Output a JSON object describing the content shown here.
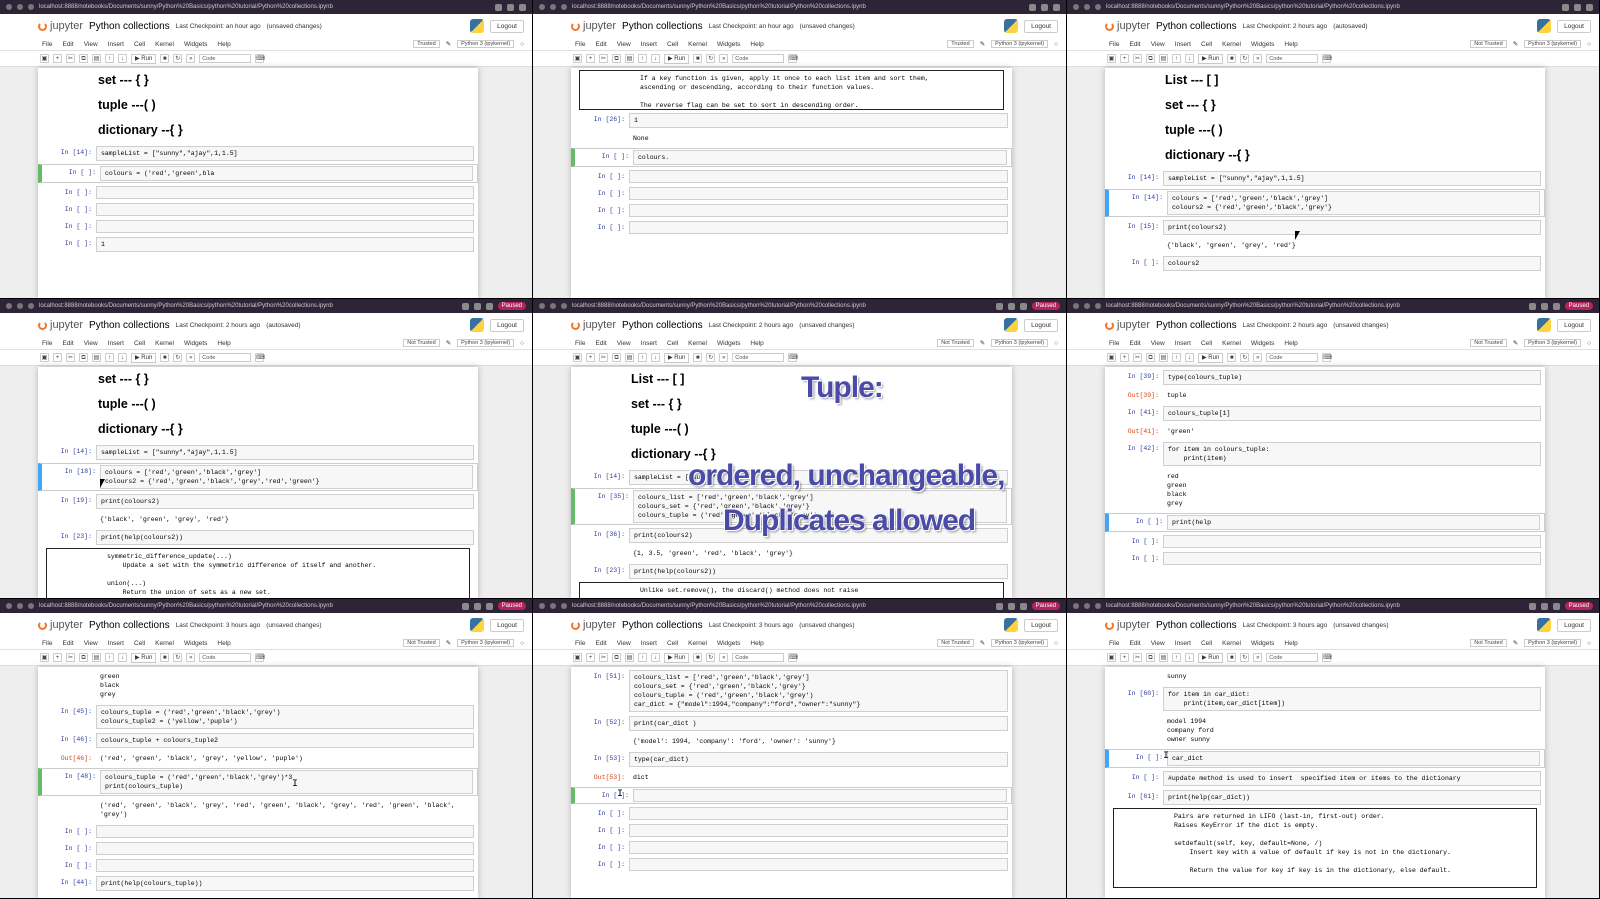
{
  "app": {
    "logo": "jupyter",
    "title": "Python collections",
    "python_label": "Python 3 (ipykernel)",
    "logout": "Logout",
    "not_trusted": "Not Trusted",
    "trusted": "Trusted",
    "paused": "Paused"
  },
  "menu": [
    "File",
    "Edit",
    "View",
    "Insert",
    "Cell",
    "Kernel",
    "Widgets",
    "Help"
  ],
  "toolbar": {
    "run": "Run",
    "celltype": "Code"
  },
  "url": "localhost:8888/notebooks/Documents/sunny/Python%20Basics/python%20tutorial/Python%20collections.ipynb",
  "frames": [
    {
      "checkpoint": "Last Checkpoint: an hour ago",
      "status": "(unsaved changes)",
      "headings": [
        "set --- { }",
        "tuple ---( )",
        "dictionary --{ }"
      ],
      "cells": [
        {
          "prompt": "In [14]:",
          "code": "sampleList = [\"sunny\",\"ajay\",1,1.5]"
        },
        {
          "prompt": "In [ ]:",
          "code": "colours = ('red','green',bla"
        },
        {
          "prompt": "In [ ]:",
          "code": ""
        },
        {
          "prompt": "In [ ]:",
          "code": ""
        },
        {
          "prompt": "In [ ]:",
          "code": ""
        },
        {
          "prompt": "In [ ]:",
          "code": "1"
        }
      ]
    },
    {
      "checkpoint": "Last Checkpoint: an hour ago",
      "status": "(unsaved changes)",
      "help": "If a key function is given, apply it once to each list item and sort them,\nascending or descending, according to their function values.\n\nThe reverse flag can be set to sort in descending order.\n\n----------------------------------------------------------------------\nClass methods defined here:",
      "cells": [
        {
          "prompt": "In [26]:",
          "code": "1"
        },
        {
          "output": "None"
        },
        {
          "prompt": "In [ ]:",
          "code": "colours."
        },
        {
          "prompt": "In [ ]:",
          "code": ""
        },
        {
          "prompt": "In [ ]:",
          "code": ""
        },
        {
          "prompt": "In [ ]:",
          "code": ""
        },
        {
          "prompt": "In [ ]:",
          "code": ""
        }
      ]
    },
    {
      "checkpoint": "Last Checkpoint: 2 hours ago",
      "status": "(autosaved)",
      "headings": [
        "List --- [ ]",
        "set --- { }",
        "tuple ---( )",
        "dictionary --{ }"
      ],
      "cells": [
        {
          "prompt": "In [14]:",
          "code": "sampleList = [\"sunny\",\"ajay\",1,1.5]"
        },
        {
          "prompt": "In [14]:",
          "code": "colours = ['red','green','black','grey']\ncolours2 = {'red','green','black','grey'}"
        },
        {
          "prompt": "In [15]:",
          "code": "print(colours2)"
        },
        {
          "output": "{'black', 'green', 'grey', 'red'}"
        },
        {
          "prompt": "In [ ]:",
          "code": "colours2"
        }
      ]
    },
    {
      "checkpoint": "Last Checkpoint: 2 hours ago",
      "status": "(autosaved)",
      "headings": [
        "set --- { }",
        "tuple ---( )",
        "dictionary --{ }"
      ],
      "cells": [
        {
          "prompt": "In [14]:",
          "code": "sampleList = [\"sunny\",\"ajay\",1,1.5]"
        },
        {
          "prompt": "In [18]:",
          "code": "colours = ['red','green','black','grey']\ncolours2 = {'red','green','black','grey','red','green'}"
        },
        {
          "prompt": "In [19]:",
          "code": "print(colours2)"
        },
        {
          "output": "{'black', 'green', 'grey', 'red'}"
        },
        {
          "prompt": "In [23]:",
          "code": "print(help(colours2))"
        }
      ],
      "help": "symmetric_difference_update(...)\n    Update a set with the symmetric difference of itself and another.\n\nunion(...)\n    Return the union of sets as a new set."
    },
    {
      "checkpoint": "Last Checkpoint: 2 hours ago",
      "status": "(unsaved changes)",
      "headings": [
        "List --- [ ]",
        "set --- { }",
        "tuple ---( )",
        "dictionary --{ }"
      ],
      "overlay": [
        "Tuple:",
        "ordered, unchangeable,",
        "Duplicates allowed"
      ],
      "cells": [
        {
          "prompt": "In [14]:",
          "code": "sampleList = [\"sunny\","
        },
        {
          "prompt": "In [35]:",
          "code": "colours_list = ['red','green','black','grey']\ncolours_set = {'red','green','black','grey'}\ncolours_tuple = ('red','green','black','grey')"
        },
        {
          "prompt": "In [36]:",
          "code": "print(colours2)"
        },
        {
          "output": "{1, 3.5, 'green', 'red', 'black', 'grey'}"
        },
        {
          "prompt": "In [23]:",
          "code": "print(help(colours2))"
        }
      ],
      "help": "Unlike set.remove(), the discard() method does not raise"
    },
    {
      "checkpoint": "Last Checkpoint: 2 hours ago",
      "status": "(unsaved changes)",
      "cells": [
        {
          "prompt": "In [39]:",
          "code": "type(colours_tuple)"
        },
        {
          "prompt": "Out[39]:",
          "output": "tuple"
        },
        {
          "prompt": "In [41]:",
          "code": "colours_tuple[1]"
        },
        {
          "prompt": "Out[41]:",
          "output": "'green'"
        },
        {
          "prompt": "In [42]:",
          "code": "for item in colours_tuple:\n    print(item)"
        },
        {
          "output": "red\ngreen\nblack\ngrey"
        },
        {
          "prompt": "In [ ]:",
          "code": "print(help"
        },
        {
          "prompt": "In [ ]:",
          "code": ""
        },
        {
          "prompt": "In [ ]:",
          "code": ""
        }
      ]
    },
    {
      "checkpoint": "Last Checkpoint: 3 hours ago",
      "status": "(unsaved changes)",
      "cells": [
        {
          "output": "green\nblack\ngrey"
        },
        {
          "prompt": "In [45]:",
          "code": "colours_tuple = ('red','green','black','grey')\ncolours_tuple2 = ('yellow','puple')"
        },
        {
          "prompt": "In [46]:",
          "code": "colours_tuple + colours_tuple2"
        },
        {
          "prompt": "Out[46]:",
          "output": "('red', 'green', 'black', 'grey', 'yellow', 'puple')"
        },
        {
          "prompt": "In [48]:",
          "code": "colours_tuple = ('red','green','black','grey')*3\nprint(colours_tuple)"
        },
        {
          "output": "('red', 'green', 'black', 'grey', 'red', 'green', 'black', 'grey', 'red', 'green', 'black',\n'grey')"
        },
        {
          "prompt": "In [ ]:",
          "code": ""
        },
        {
          "prompt": "In [ ]:",
          "code": ""
        },
        {
          "prompt": "In [ ]:",
          "code": ""
        },
        {
          "prompt": "In [44]:",
          "code": "print(help(colours_tuple))"
        }
      ]
    },
    {
      "checkpoint": "Last Checkpoint: 3 hours ago",
      "status": "(unsaved changes)",
      "cells": [
        {
          "prompt": "In [51]:",
          "code": "colours_list = ['red','green','black','grey']\ncolours_set = {'red','green','black','grey'}\ncolours_tuple = ('red','green','black','grey')\ncar_dict = {\"model\":1994,\"company\":\"ford\",\"owner\":\"sunny\"}"
        },
        {
          "prompt": "In [52]:",
          "code": "print(car_dict )"
        },
        {
          "output": "{'model': 1994, 'company': 'ford', 'owner': 'sunny'}"
        },
        {
          "prompt": "In [53]:",
          "code": "type(car_dict)"
        },
        {
          "prompt": "Out[53]:",
          "output": "dict"
        },
        {
          "prompt": "In [ ]:",
          "code": ""
        },
        {
          "prompt": "In [ ]:",
          "code": ""
        },
        {
          "prompt": "In [ ]:",
          "code": ""
        },
        {
          "prompt": "In [ ]:",
          "code": ""
        },
        {
          "prompt": "In [ ]:",
          "code": ""
        }
      ]
    },
    {
      "checkpoint": "Last Checkpoint: 3 hours ago",
      "status": "(unsaved changes)",
      "cells": [
        {
          "output": "sunny"
        },
        {
          "prompt": "In [60]:",
          "code": "for item in car_dict:\n    print(item,car_dict[item])"
        },
        {
          "output": "model 1994\ncompany ford\nowner sunny"
        },
        {
          "prompt": "In [ ]:",
          "code": "car_dict"
        },
        {
          "prompt": "In [ ]:",
          "code": "#update method is used to insert  specified item or items to the dictionary"
        },
        {
          "prompt": "In [61]:",
          "code": "print(help(car_dict))"
        }
      ],
      "help": "Pairs are returned in LIFO (last-in, first-out) order.\nRaises KeyError if the dict is empty.\n\nsetdefault(self, key, default=None, /)\n    Insert key with a value of default if key is not in the dictionary.\n\n    Return the value for key if key is in the dictionary, else default."
    }
  ]
}
